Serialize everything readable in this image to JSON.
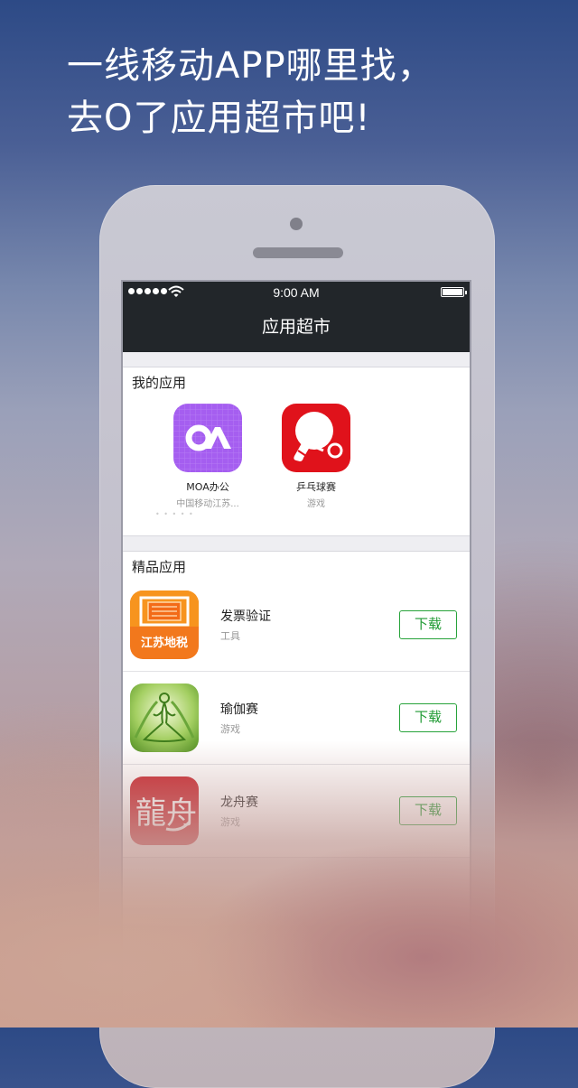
{
  "headline": {
    "line1": "一线移动APP哪里找，",
    "line2": "去O了应用超市吧!"
  },
  "status_bar": {
    "time": "9:00 AM"
  },
  "nav": {
    "title": "应用超市"
  },
  "my_apps": {
    "title": "我的应用",
    "items": [
      {
        "name": "MOA办公",
        "sub": "中国移动江苏...",
        "icon": "moa-logo-icon",
        "color": "#a55ef0"
      },
      {
        "name": "乒乓球赛",
        "sub": "游戏",
        "icon": "ping-pong-paddle-icon",
        "color": "#e0121b"
      }
    ]
  },
  "featured": {
    "title": "精品应用",
    "items": [
      {
        "name": "发票验证",
        "category": "工具",
        "button": "下载",
        "icon": "jiangsu-tax-icon",
        "icon_text": "江苏地税"
      },
      {
        "name": "瑜伽赛",
        "category": "游戏",
        "button": "下载",
        "icon": "yoga-figure-icon"
      },
      {
        "name": "龙舟赛",
        "category": "游戏",
        "button": "下载",
        "icon": "dragon-boat-calligraphy-icon",
        "icon_text": "龍舟"
      }
    ]
  },
  "colors": {
    "nav_bg": "#22262a",
    "download_green": "#27a33a"
  }
}
